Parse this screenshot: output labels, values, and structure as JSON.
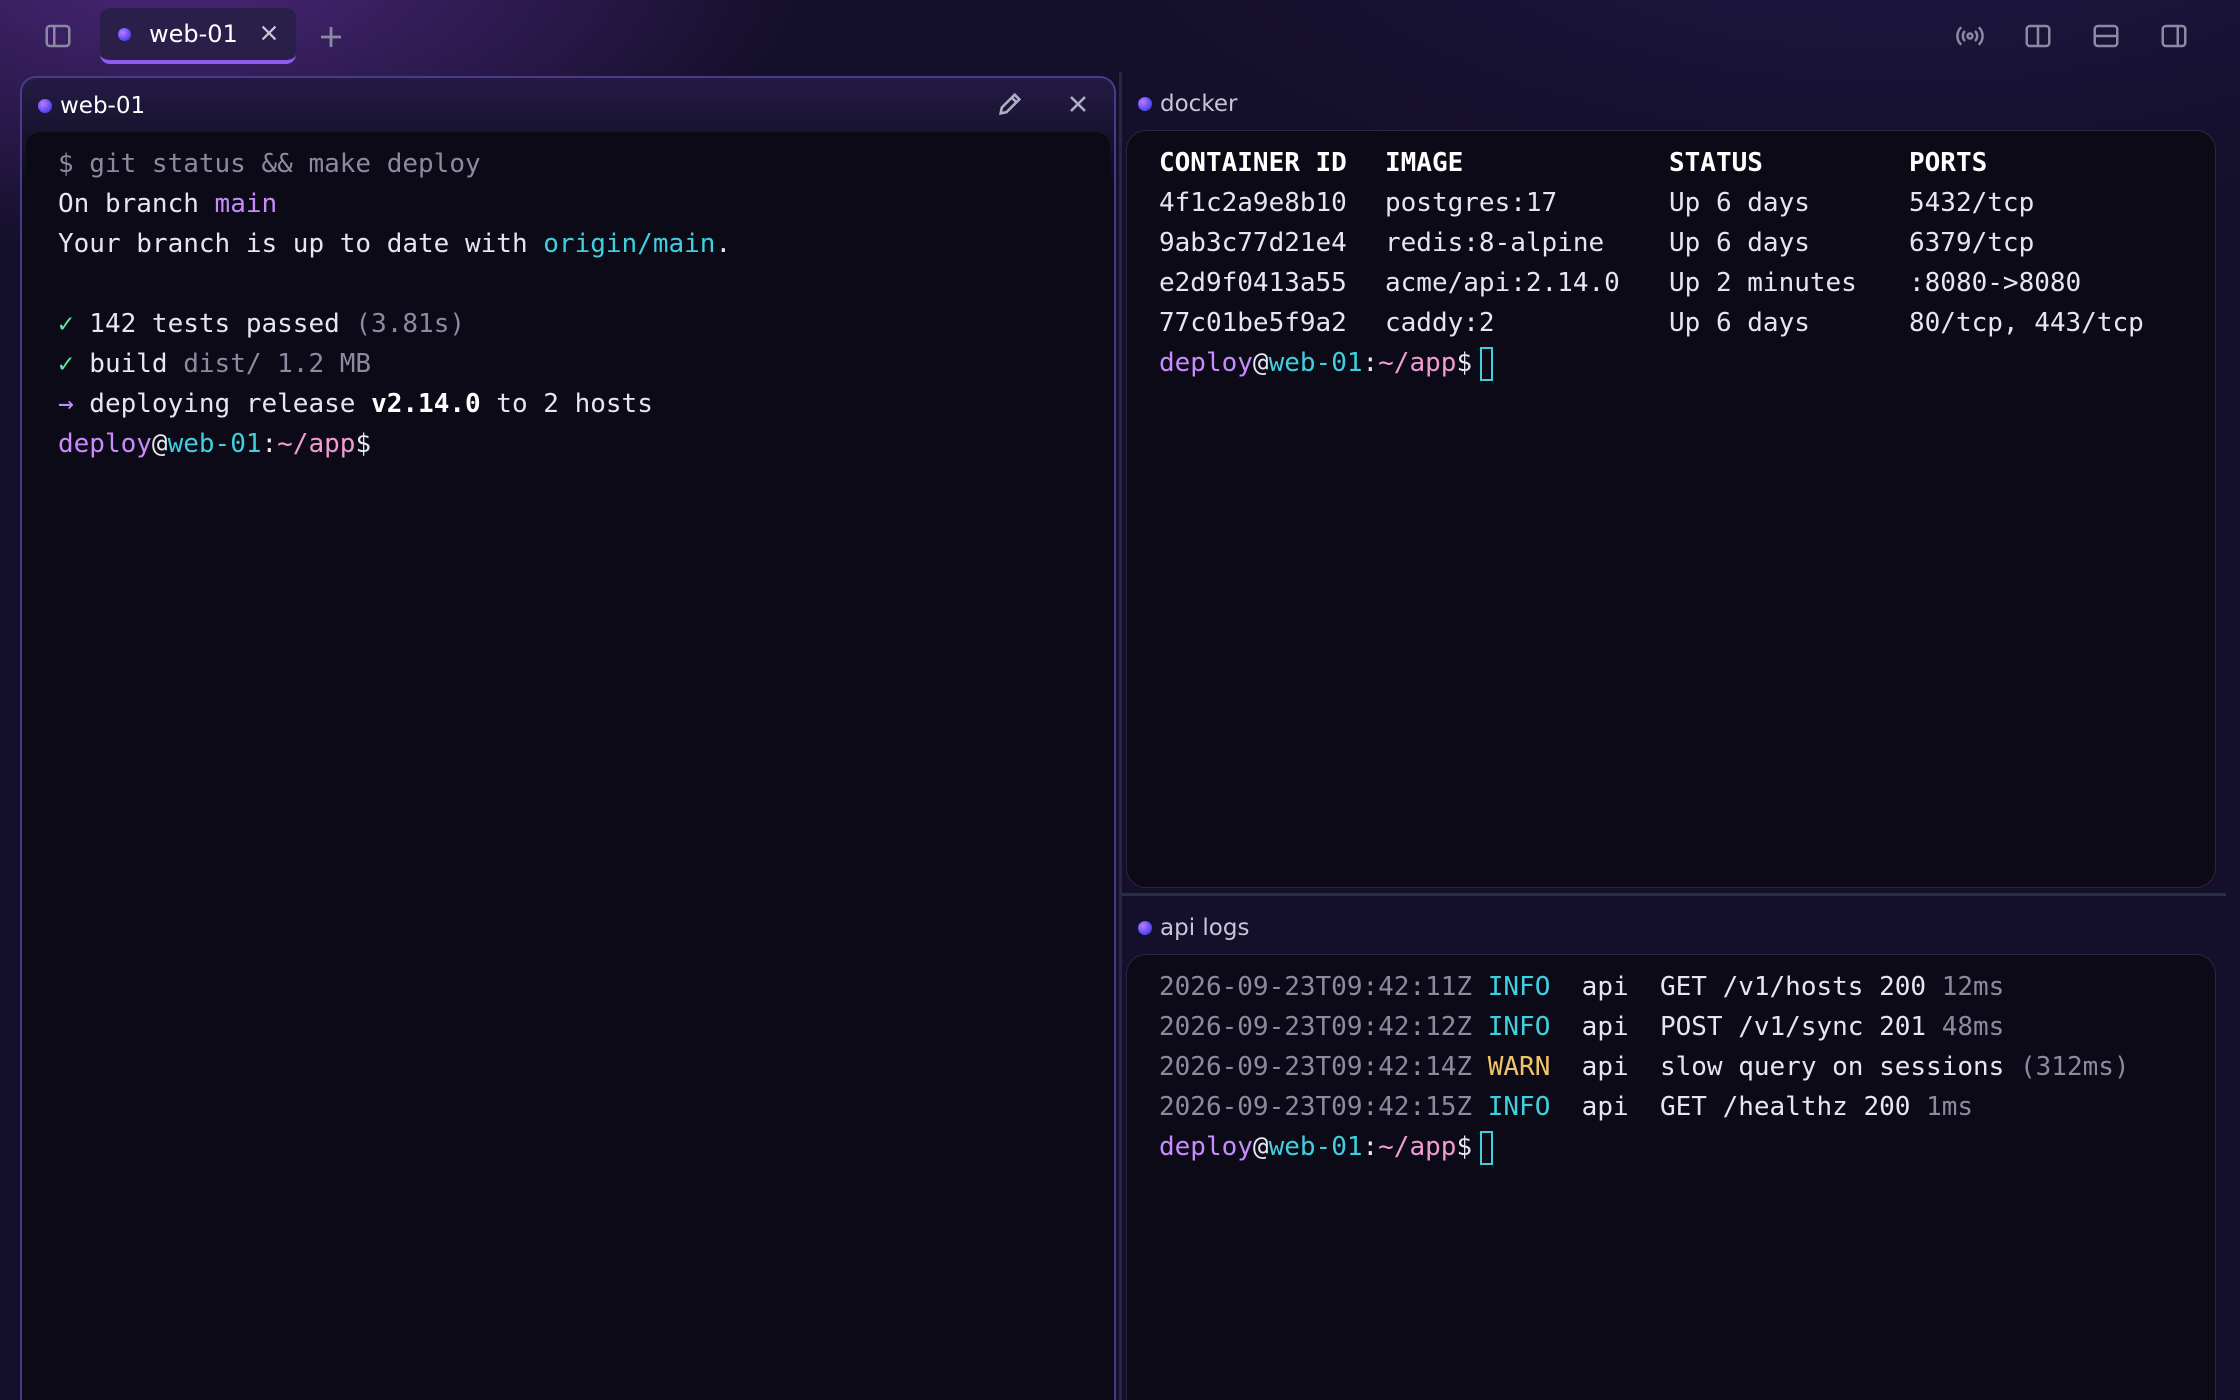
{
  "tab": {
    "label": "web-01"
  },
  "left_pane": {
    "title": "web-01",
    "lines": {
      "cmd": "$ git status && make deploy",
      "branch_prefix": "On branch ",
      "branch": "main",
      "uptodate_prefix": "Your branch is up to date with ",
      "remote": "origin/main",
      "uptodate_suffix": ".",
      "tests_check": "✓",
      "tests_text": " 142 tests passed ",
      "tests_time": "(3.81s)",
      "build_check": "✓",
      "build_text": " build ",
      "build_detail": "dist/ 1.2 MB",
      "deploy_arrow": "→",
      "deploy_text": " deploying release ",
      "deploy_version": "v2.14.0",
      "deploy_suffix": " to 2 hosts"
    }
  },
  "prompt": {
    "user": "deploy",
    "at": "@",
    "host": "web-01",
    "colon": ":",
    "path": "~/app",
    "sign": "$"
  },
  "docker_pane": {
    "title": "docker",
    "headers": [
      "CONTAINER ID",
      "IMAGE",
      "STATUS",
      "PORTS"
    ],
    "rows": [
      [
        "4f1c2a9e8b10",
        "postgres:17",
        "Up 6 days",
        "5432/tcp"
      ],
      [
        "9ab3c77d21e4",
        "redis:8-alpine",
        "Up 6 days",
        "6379/tcp"
      ],
      [
        "e2d9f0413a55",
        "acme/api:2.14.0",
        "Up 2 minutes",
        ":8080->8080"
      ],
      [
        "77c01be5f9a2",
        "caddy:2",
        "Up 6 days",
        "80/tcp, 443/tcp"
      ]
    ]
  },
  "logs_pane": {
    "title": "api logs",
    "rows": [
      {
        "ts": "2026-09-23T09:42:11Z",
        "level": "INFO",
        "svc": "api",
        "msg": "GET /v1/hosts 200",
        "extra": "12ms"
      },
      {
        "ts": "2026-09-23T09:42:12Z",
        "level": "INFO",
        "svc": "api",
        "msg": "POST /v1/sync 201",
        "extra": "48ms"
      },
      {
        "ts": "2026-09-23T09:42:14Z",
        "level": "WARN",
        "svc": "api",
        "msg": "slow query on sessions",
        "extra": "(312ms)"
      },
      {
        "ts": "2026-09-23T09:42:15Z",
        "level": "INFO",
        "svc": "api",
        "msg": "GET /healthz 200",
        "extra": "1ms"
      }
    ]
  },
  "icons": {
    "sidebar": "sidebar-toggle-icon",
    "broadcast": "broadcast-icon",
    "split_v": "split-vertical-icon",
    "split_h": "split-horizontal-icon",
    "right_panel": "right-panel-icon",
    "edit": "pencil-icon",
    "close": "close-icon",
    "add": "plus-icon"
  },
  "colors": {
    "accent": "#8f5cf0",
    "cyan": "#3fd0e0",
    "green": "#5ee6a3",
    "warn": "#f2c46a",
    "user": "#c78bff",
    "path": "#f29cd2"
  }
}
